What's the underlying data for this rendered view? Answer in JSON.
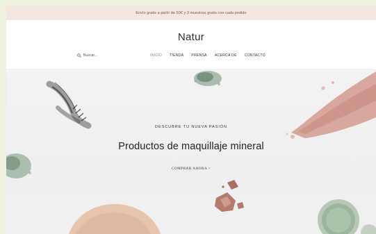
{
  "announcement": "Envío gratis a partir de 50€ y 3 muestras gratis con cada pedido",
  "header": {
    "logo": "Natur",
    "search_placeholder": "Buscar...",
    "nav": [
      {
        "label": "INICIO",
        "active": true
      },
      {
        "label": "TIENDA",
        "active": false
      },
      {
        "label": "PRENSA",
        "active": false
      },
      {
        "label": "ACERCA DE",
        "active": false
      },
      {
        "label": "CONTACTO",
        "active": false
      }
    ]
  },
  "hero": {
    "kicker": "DESCUBRE TU NUEVA PASIÓN",
    "title": "Productos de maquillaje mineral",
    "cta": "COMPRAR AHORA >"
  },
  "colors": {
    "outer_background": "#eef1dd",
    "announcement_bar": "#f4e6e0",
    "hero_background": "#f1f1f1",
    "pink_swatch": "#d49a8e",
    "green_swatch": "#8ba892",
    "nude_swatch": "#e7c5ad"
  },
  "icons": {
    "search": "search-icon"
  }
}
